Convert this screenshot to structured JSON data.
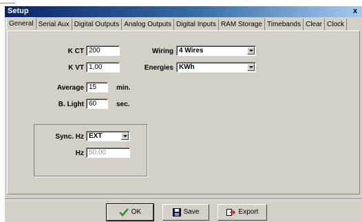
{
  "window": {
    "title": "Setup",
    "close_label": "x"
  },
  "tabs": [
    "General",
    "Serial Aux",
    "Digital Outputs",
    "Analog Outputs",
    "Digital Inputs",
    "RAM Storage",
    "Timebands",
    "Clear",
    "Clock"
  ],
  "general": {
    "kct": {
      "label": "K CT",
      "value": "200"
    },
    "kvt": {
      "label": "K VT",
      "value": "1,00"
    },
    "average": {
      "label": "Average",
      "value": "15",
      "unit": "min."
    },
    "blight": {
      "label": "B. Light",
      "value": "60",
      "unit": "sec."
    },
    "wiring": {
      "label": "Wiring",
      "value": "4 Wires"
    },
    "energies": {
      "label": "Energies",
      "value": "KWh"
    },
    "sync": {
      "label": "Sync. Hz",
      "value": "EXT"
    },
    "hz": {
      "label": "Hz",
      "value": "50,00"
    }
  },
  "buttons": {
    "ok": "OK",
    "save": "Save",
    "export": "Export"
  },
  "icons": {
    "ok": "checkmark-icon",
    "save": "floppy-disk-icon",
    "export": "export-icon"
  },
  "colors": {
    "titlebar_start": "#0a246a",
    "titlebar_end": "#a6caf0",
    "face": "#d4d0c8",
    "check_green": "#2f8f2f"
  }
}
